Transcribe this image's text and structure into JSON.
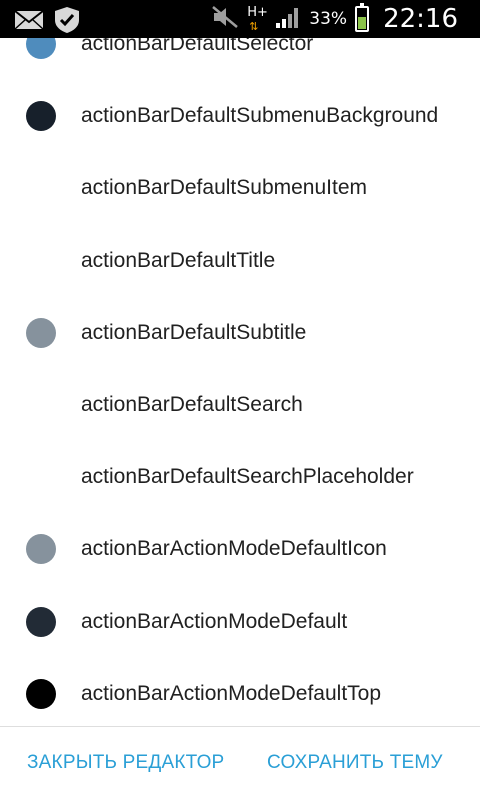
{
  "status_bar": {
    "icons_left": [
      "mail-icon",
      "shield-check-icon"
    ],
    "icons_right": [
      "mute-icon",
      "network-h-plus-icon",
      "signal-icon",
      "battery-icon"
    ],
    "network_type": "H+",
    "battery_percent": "33%",
    "battery_level": 0.33,
    "time": "22:16"
  },
  "colors": {
    "accent": "#2a9fd6",
    "text": "#212121"
  },
  "items": [
    {
      "label": "actionBarDefaultSelector",
      "color": "#4f8cbd"
    },
    {
      "label": "actionBarDefaultSubmenuBackground",
      "color": "#17202b"
    },
    {
      "label": "actionBarDefaultSubmenuItem",
      "color": ""
    },
    {
      "label": "actionBarDefaultTitle",
      "color": ""
    },
    {
      "label": "actionBarDefaultSubtitle",
      "color": "#86929d"
    },
    {
      "label": "actionBarDefaultSearch",
      "color": ""
    },
    {
      "label": "actionBarDefaultSearchPlaceholder",
      "color": ""
    },
    {
      "label": "actionBarActionModeDefaultIcon",
      "color": "#86929d"
    },
    {
      "label": "actionBarActionModeDefault",
      "color": "#222b36"
    },
    {
      "label": "actionBarActionModeDefaultTop",
      "color": "#000000"
    }
  ],
  "footer": {
    "close_label": "ЗАКРЫТЬ РЕДАКТОР",
    "save_label": "СОХРАНИТЬ ТЕМУ"
  }
}
